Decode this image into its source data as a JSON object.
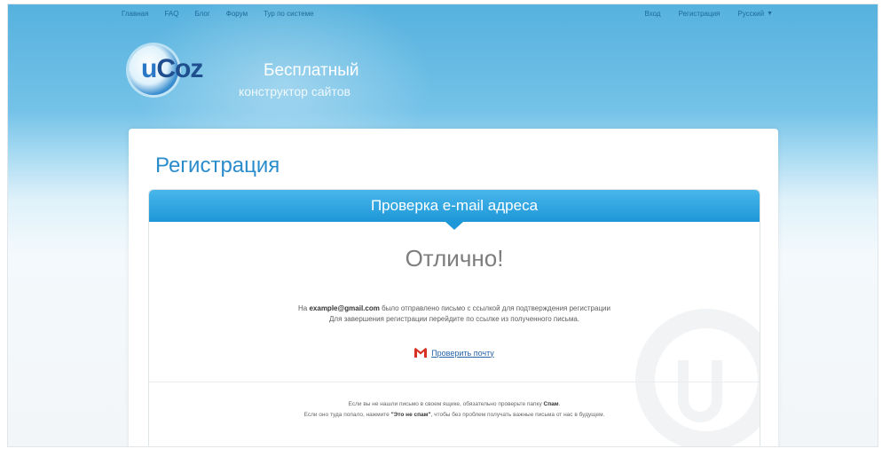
{
  "topnav": {
    "left": [
      "Главная",
      "FAQ",
      "Блог",
      "Форум",
      "Тур по системе"
    ],
    "right": [
      "Вход",
      "Регистрация"
    ],
    "language": "Русский"
  },
  "logo": {
    "text_prefix": "u",
    "text_main": "Coz",
    "tagline_1": "Бесплатный",
    "tagline_2": "конструктор сайтов"
  },
  "page": {
    "title": "Регистрация",
    "banner": "Проверка e-mail адреса",
    "headline": "Отлично!",
    "msg_prefix": "На",
    "email": "example@gmail.com",
    "msg_line1_rest": "было отправлено письмо с ссылкой для подтверждения регистрации",
    "msg_line2": "Для завершения регистрации перейдите по ссылке из полученного письма.",
    "check_mail_link": "Проверить почту",
    "check_mail_icon": "gmail-icon",
    "foot_line1_prefix": "Если вы не нашли письмо в своем ящике, обязательно проверьте папку",
    "foot_spam": "Спам",
    "foot_line2_prefix": "Если оно туда попало, нажмите",
    "foot_not_spam": "\"Это не спам\"",
    "foot_line2_rest": ", чтобы без проблем получать важные письма от нас в будущем."
  },
  "colors": {
    "accent": "#2a8ccb",
    "banner": "#1e97d8",
    "link": "#2463a8"
  }
}
